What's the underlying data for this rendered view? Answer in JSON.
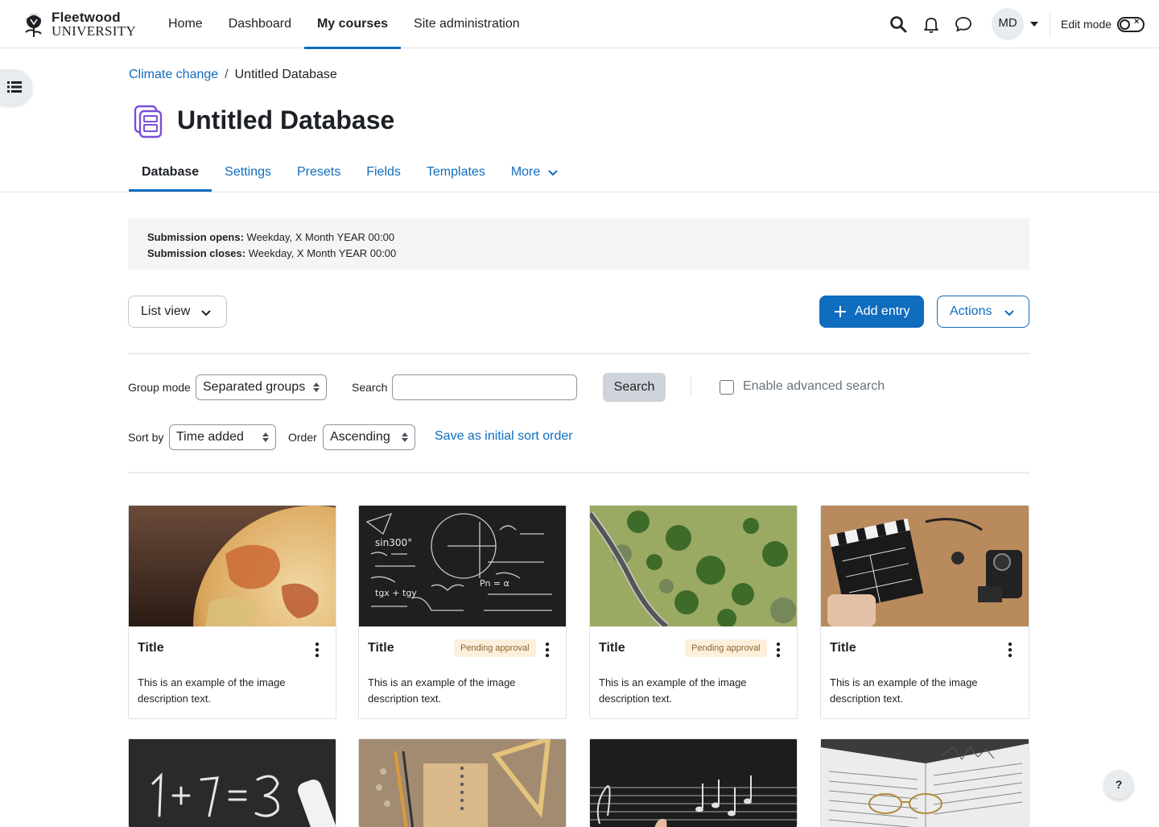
{
  "brand": {
    "name_line1": "Fleetwood",
    "name_line2": "UNIVERSITY"
  },
  "primary_nav": [
    {
      "label": "Home",
      "active": false
    },
    {
      "label": "Dashboard",
      "active": false
    },
    {
      "label": "My courses",
      "active": true
    },
    {
      "label": "Site administration",
      "active": false
    }
  ],
  "user": {
    "initials": "MD"
  },
  "edit_mode": {
    "label": "Edit mode",
    "on": false
  },
  "breadcrumb": {
    "parent": "Climate change",
    "separator": "/",
    "current": "Untitled Database"
  },
  "page_title": "Untitled Database",
  "secondary_nav": [
    {
      "label": "Database",
      "active": true
    },
    {
      "label": "Settings",
      "active": false
    },
    {
      "label": "Presets",
      "active": false
    },
    {
      "label": "Fields",
      "active": false
    },
    {
      "label": "Templates",
      "active": false
    },
    {
      "label": "More",
      "active": false
    }
  ],
  "dates": {
    "opens_label": "Submission opens:",
    "opens_value": "Weekday, X Month YEAR 00:00",
    "closes_label": "Submission closes:",
    "closes_value": "Weekday, X Month YEAR 00:00"
  },
  "toolbar": {
    "view_select": "List view",
    "add_entry": "Add entry",
    "actions": "Actions"
  },
  "filters": {
    "group_mode_label": "Group mode",
    "group_mode_value": "Separated groups",
    "search_label": "Search",
    "search_value": "",
    "search_button": "Search",
    "advanced_search_label": "Enable advanced search",
    "advanced_search_checked": false,
    "sort_by_label": "Sort by",
    "sort_by_value": "Time added",
    "order_label": "Order",
    "order_value": "Ascending",
    "save_sort_link": "Save as initial sort order"
  },
  "entries": [
    {
      "title": "Title",
      "badge": "",
      "description": "This is an example of the image description text.",
      "image": "globe"
    },
    {
      "title": "Title",
      "badge": "Pending approval",
      "description": "This is an example of the image description text.",
      "image": "chalkboard-math"
    },
    {
      "title": "Title",
      "badge": "Pending approval",
      "description": "This is an example of the image description text.",
      "image": "aerial-road"
    },
    {
      "title": "Title",
      "badge": "",
      "description": "This is an example of the image description text.",
      "image": "clapperboard-camera"
    },
    {
      "title": "",
      "badge": "",
      "description": "",
      "image": "chalk-1plus1"
    },
    {
      "title": "",
      "badge": "",
      "description": "",
      "image": "notebook-stationery"
    },
    {
      "title": "",
      "badge": "",
      "description": "",
      "image": "music-chalkboard"
    },
    {
      "title": "",
      "badge": "",
      "description": "",
      "image": "open-book-glasses"
    }
  ],
  "help_button": "?",
  "colors": {
    "primary": "#0f6cbf",
    "badge_bg": "#fcefdc",
    "badge_text": "#8e662e",
    "text": "#1d2125"
  }
}
